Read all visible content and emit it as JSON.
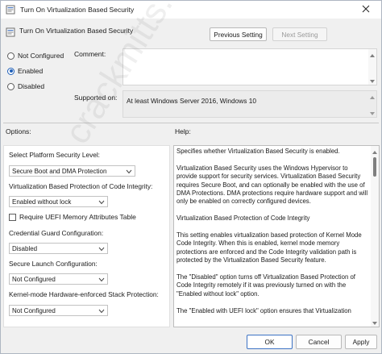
{
  "window": {
    "title": "Turn On Virtualization Based Security"
  },
  "header": {
    "setting_title": "Turn On Virtualization Based Security",
    "previous_label": "Previous Setting",
    "next_label": "Next Setting"
  },
  "state": {
    "options": [
      {
        "label": "Not Configured",
        "checked": false
      },
      {
        "label": "Enabled",
        "checked": true
      },
      {
        "label": "Disabled",
        "checked": false
      }
    ]
  },
  "comment": {
    "label": "Comment:",
    "value": ""
  },
  "supported": {
    "label": "Supported on:",
    "value": "At least Windows Server 2016, Windows 10"
  },
  "options_panel": {
    "heading": "Options:",
    "platform_label": "Select Platform Security Level:",
    "platform_value": "Secure Boot and DMA Protection",
    "vbs_code_label": "Virtualization Based Protection of Code Integrity:",
    "vbs_code_value": "Enabled without lock",
    "uefi_label": "Require UEFI Memory Attributes Table",
    "credential_label": "Credential Guard Configuration:",
    "credential_value": "Disabled",
    "secure_launch_label": "Secure Launch Configuration:",
    "secure_launch_value": "Not Configured",
    "kernel_stack_label": "Kernel-mode Hardware-enforced Stack Protection:",
    "kernel_stack_value": "Not Configured"
  },
  "help_panel": {
    "heading": "Help:",
    "p1": "Specifies whether Virtualization Based Security is enabled.",
    "p2": "Virtualization Based Security uses the Windows Hypervisor to provide support for security services. Virtualization Based Security requires Secure Boot, and can optionally be enabled with the use of DMA Protections. DMA protections require hardware support and will only be enabled on correctly configured devices.",
    "p3": "Virtualization Based Protection of Code Integrity",
    "p4": "This setting enables virtualization based protection of Kernel Mode Code Integrity. When this is enabled, kernel mode memory protections are enforced and the Code Integrity validation path is protected by the Virtualization Based Security feature.",
    "p5": "The \"Disabled\" option turns off Virtualization Based Protection of Code Integrity remotely if it was previously turned on with the \"Enabled without lock\" option.",
    "p6": "The \"Enabled with UEFI lock\" option ensures that Virtualization"
  },
  "footer": {
    "ok_label": "OK",
    "cancel_label": "Cancel",
    "apply_label": "Apply"
  },
  "watermark": "crackmitts.co.uk"
}
